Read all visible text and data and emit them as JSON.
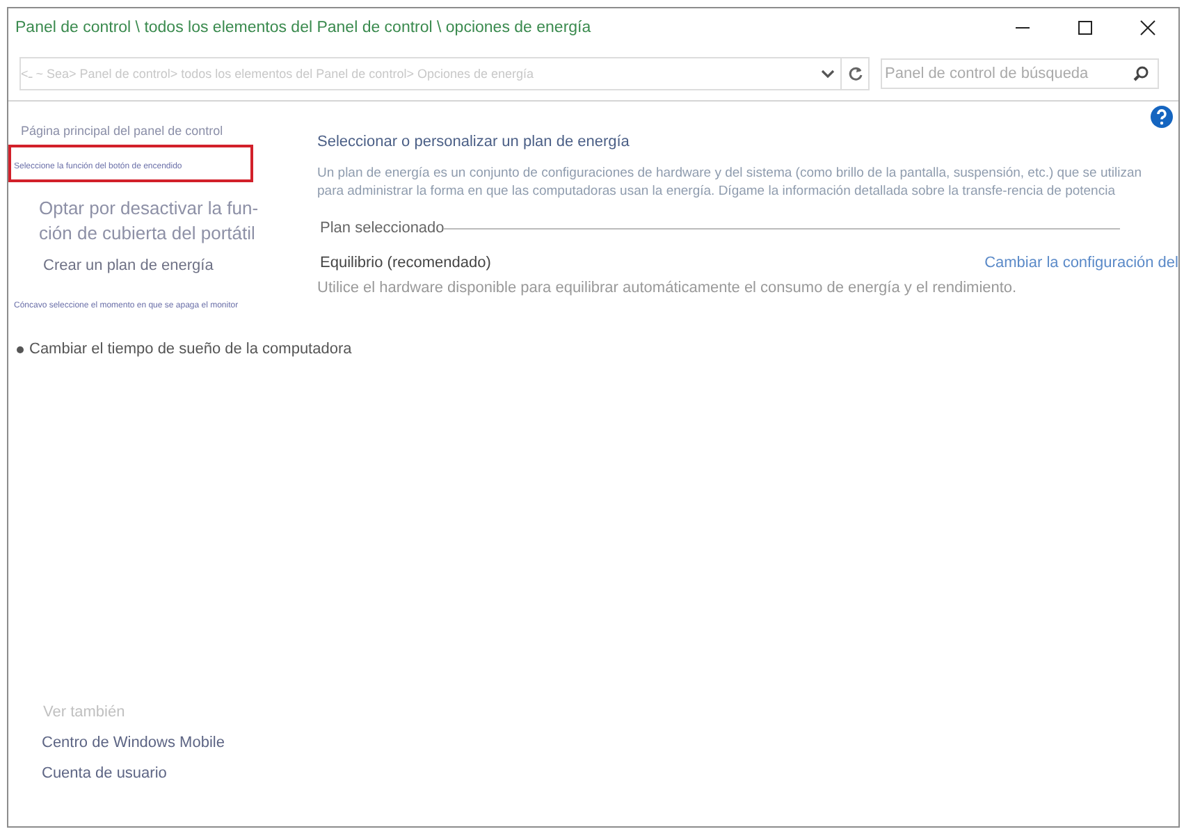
{
  "window": {
    "title": "Panel de control \\ todos los elementos del Panel de control \\ opciones de energía"
  },
  "address_bar": {
    "path": "<ـ ~ Sea> Panel de control> todos los elementos del Panel de control> Opciones de energía"
  },
  "search": {
    "placeholder": "Panel de control de búsqueda"
  },
  "sidebar": {
    "items": [
      {
        "kind": "normal",
        "label": "Página principal del panel de control",
        "highlighted": false
      },
      {
        "kind": "tiny",
        "label": "Seleccione la función del botón de encendido",
        "highlighted": true
      },
      {
        "kind": "large",
        "label": "Optar por desactivar la fun-ción de cubierta del portátil",
        "highlighted": false
      },
      {
        "kind": "medium",
        "label": "Crear un plan de energía",
        "highlighted": false
      },
      {
        "kind": "tiny",
        "label": "Cóncavo seleccione el momento en que se apaga el monitor",
        "highlighted": false
      },
      {
        "kind": "bullet",
        "label": "Cambiar el tiempo de sueño de la computadora",
        "highlighted": false
      }
    ],
    "see_also": {
      "title": "Ver también",
      "links": [
        "Centro de Windows Mobile",
        "Cuenta de usuario"
      ]
    }
  },
  "main": {
    "heading": "Seleccionar o personalizar un plan de energía",
    "description": "Un plan de energía es un conjunto de configuraciones de hardware y del sistema (como brillo de la pantalla, suspensión, etc.) que se utilizan para administrar la forma en que las computadoras usan la energía. Dígame la información detallada sobre la transfe-rencia de potencia",
    "section_title": "Plan seleccionado",
    "plan": {
      "name": "Equilibrio (recomendado)",
      "link": "Cambiar la configuración del",
      "description": "Utilice el hardware disponible para equilibrar automáticamente el consumo de energía y el rendimiento."
    }
  }
}
